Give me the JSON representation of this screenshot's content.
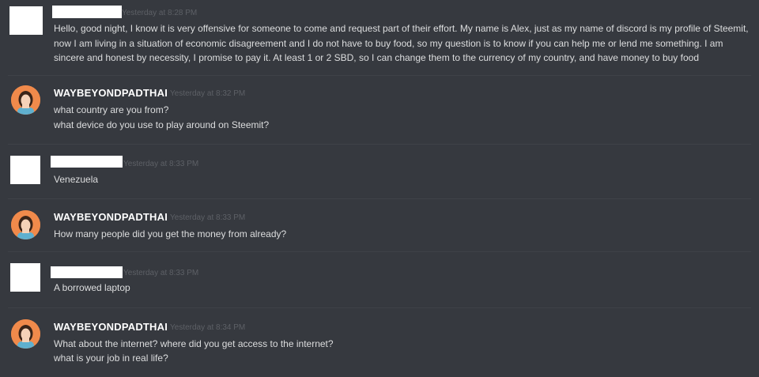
{
  "messages": [
    {
      "author": "",
      "timestamp": "Yesterday at 8:28 PM",
      "lines": [
        "Hello, good night, I know it is very offensive for someone to come and request part of their effort. My name is Alex, just as my name of discord is my profile of Steemit, now I am living in a situation of economic disagreement and I do not have to buy food, so my question is to know if you can help me or lend me something. I am sincere and honest by necessity, I promise to pay it. At least 1 or 2 SBD, so I can change them to the currency of my country, and have money to buy food"
      ]
    },
    {
      "author": "WAYBEYONDPADTHAI",
      "timestamp": "Yesterday at 8:32 PM",
      "lines": [
        "what country are you from?",
        "what device do you use to play around on Steemit?"
      ]
    },
    {
      "author": "",
      "timestamp": "Yesterday at 8:33 PM",
      "lines": [
        "Venezuela"
      ]
    },
    {
      "author": "WAYBEYONDPADTHAI",
      "timestamp": "Yesterday at 8:33 PM",
      "lines": [
        "How many people did you get the money from already?"
      ]
    },
    {
      "author": "",
      "timestamp": "Yesterday at 8:33 PM",
      "lines": [
        "A borrowed laptop"
      ]
    },
    {
      "author": "WAYBEYONDPADTHAI",
      "timestamp": "Yesterday at 8:34 PM",
      "lines": [
        "What about the internet? where did you get access to the internet?",
        "what is your job in real life?"
      ]
    }
  ],
  "colors": {
    "background": "#36393f",
    "username": "#ffffff",
    "message_text": "#dcddde",
    "timestamp": "#5d6066",
    "avatar_accent": "#f08a4b"
  }
}
